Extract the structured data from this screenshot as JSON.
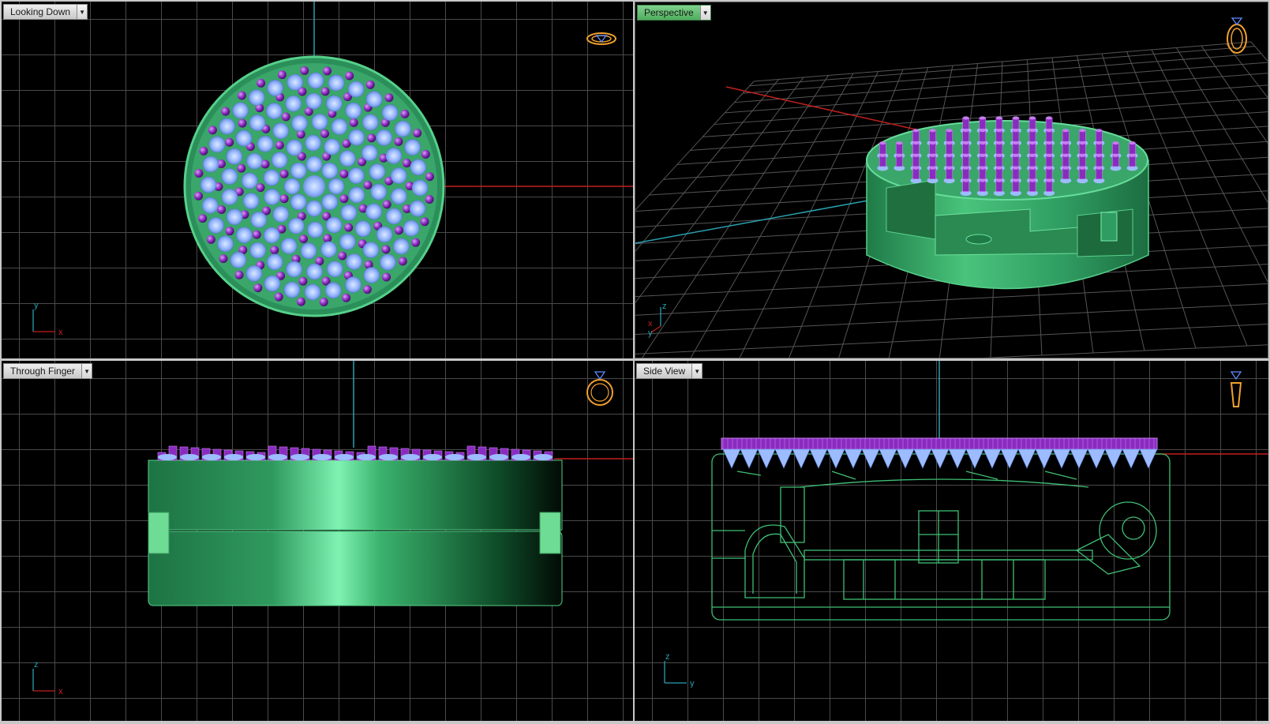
{
  "viewports": [
    {
      "id": "top",
      "label": "Looking Down",
      "active": false,
      "axes": [
        "y",
        "x"
      ],
      "icon": "ring-top-view-icon"
    },
    {
      "id": "persp",
      "label": "Perspective",
      "active": true,
      "axes": [
        "z",
        "x",
        "y"
      ],
      "icon": "ring-perspective-icon"
    },
    {
      "id": "front",
      "label": "Through Finger",
      "active": false,
      "axes": [
        "z",
        "x"
      ],
      "icon": "ring-front-view-icon"
    },
    {
      "id": "side",
      "label": "Side View",
      "active": false,
      "axes": [
        "z",
        "y"
      ],
      "icon": "ring-side-view-icon"
    }
  ],
  "dropdown_icon": "chevron-down-icon",
  "colors": {
    "background": "#000000",
    "grid": "#4a4a4a",
    "axis_x": "#c0201e",
    "axis_y": "#2aa0b0",
    "ring_green": "#3fbf73",
    "gem_blue": "#8fb4ff",
    "prong_purple": "#8a2bc0",
    "view_icon": "#f0a030",
    "active_label": "#5dbd6b"
  }
}
